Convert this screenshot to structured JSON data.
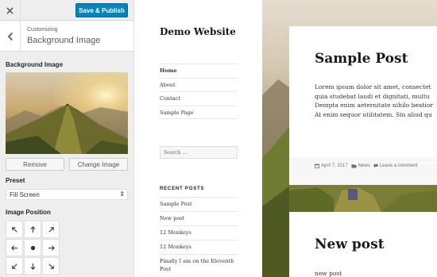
{
  "customizer": {
    "publish_label": "Save & Publish",
    "breadcrumb": "Customizing",
    "section_title": "Background Image",
    "bg_image_label": "Background Image",
    "remove_label": "Remove",
    "change_label": "Change Image",
    "preset_label": "Preset",
    "preset_value": "Fill Screen",
    "position_label": "Image Position"
  },
  "site": {
    "title": "Demo Website",
    "nav": [
      "Home",
      "About",
      "Contact",
      "Sample Page"
    ],
    "search_placeholder": "Search …",
    "recent_heading": "RECENT POSTS",
    "recent_posts": [
      "Sample Post",
      "New post",
      "12 Monkeys",
      "12 Monkeys",
      "Finally I am on the Eleventh Post"
    ]
  },
  "posts": [
    {
      "title": "Sample Post",
      "excerpt": [
        "Lorem ipsum dolor sit amet, consectet",
        "quia studebat laudi et dignitati, multu",
        "Dempta enim aeternitate nihilo beatior",
        "At enim sequor utilitatem. Sin aliud qu"
      ],
      "date": "April 7, 2017",
      "category": "News",
      "comment_link": "Leave a comment"
    },
    {
      "title": "New post",
      "excerpt_start": "new post"
    }
  ],
  "colors": {
    "accent": "#0085ba",
    "panel_bg": "#eeeeee"
  }
}
